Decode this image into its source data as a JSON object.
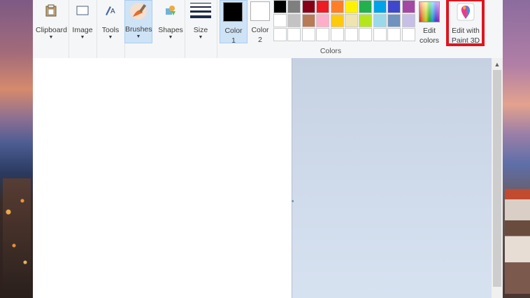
{
  "ribbon": {
    "clipboard_label": "Clipboard",
    "image_label": "Image",
    "tools_label": "Tools",
    "brushes_label": "Brushes",
    "shapes_label": "Shapes",
    "size_label": "Size",
    "color1_line1": "Color",
    "color1_line2": "1",
    "color2_line1": "Color",
    "color2_line2": "2",
    "edit_colors_line1": "Edit",
    "edit_colors_line2": "colors",
    "edit_paint3d_line1": "Edit with",
    "edit_paint3d_line2": "Paint 3D",
    "colors_group_label": "Colors",
    "color1_value": "#000000",
    "color2_value": "#ffffff"
  },
  "palette": {
    "row1": [
      "#000000",
      "#7f7f7f",
      "#880015",
      "#ed1c24",
      "#ff7f27",
      "#fff200",
      "#22b14c",
      "#00a2e8",
      "#3f48cc",
      "#a349a4"
    ],
    "row2": [
      "#ffffff",
      "#c3c3c3",
      "#b97a57",
      "#ffaec9",
      "#ffc90e",
      "#efe4b0",
      "#b5e61d",
      "#99d9ea",
      "#7092be",
      "#c8bfe7"
    ],
    "row3": [
      "#ffffff",
      "#ffffff",
      "#ffffff",
      "#ffffff",
      "#ffffff",
      "#ffffff",
      "#ffffff",
      "#ffffff",
      "#ffffff",
      "#ffffff"
    ]
  },
  "icons": {
    "clipboard": "clipboard-icon",
    "image": "select-icon",
    "tools": "tools-icon",
    "brushes": "brush-icon",
    "shapes": "shapes-icon",
    "size": "line-size-icon",
    "edit_colors": "rainbow-icon",
    "paint3d": "paint3d-icon"
  },
  "accent": {
    "highlight_border": "#e0141e",
    "selected_bg": "#cfe3f7"
  }
}
